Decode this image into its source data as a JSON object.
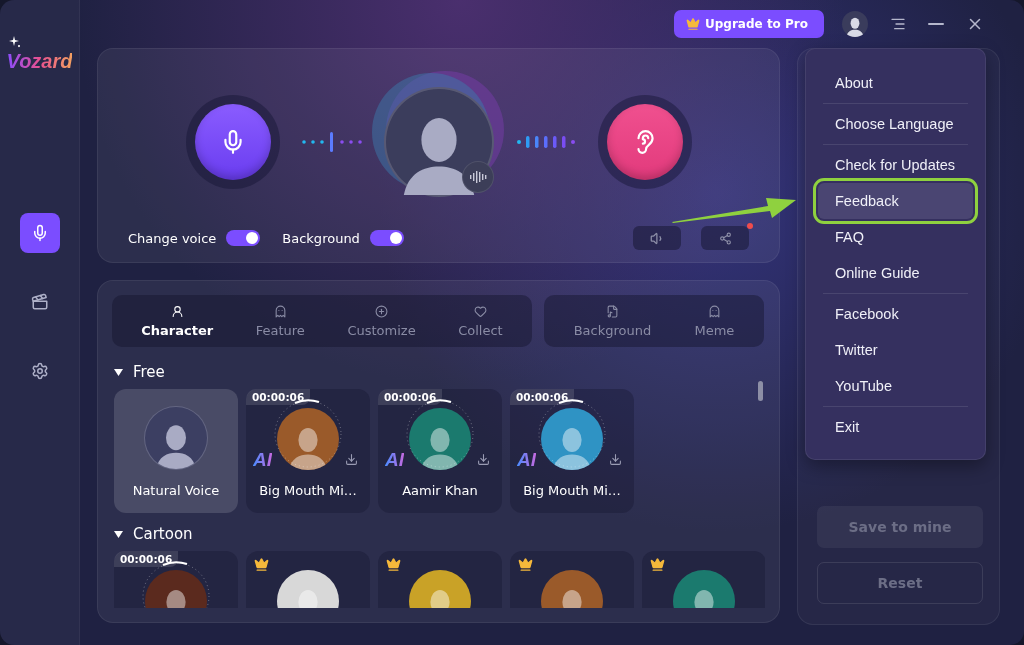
{
  "app": {
    "logo": "Vozard"
  },
  "sidebar": {
    "items": [
      {
        "kind": "voice",
        "selected": true
      },
      {
        "kind": "video",
        "selected": false
      },
      {
        "kind": "settings",
        "selected": false
      }
    ]
  },
  "top_bar": {
    "upgrade_button": "Upgrade to Pro"
  },
  "studio": {
    "toggles": [
      {
        "label": "Change voice",
        "on": true
      },
      {
        "label": "Background",
        "on": true
      }
    ],
    "share_notification": true
  },
  "tab_groups": [
    {
      "tabs": [
        {
          "label": "Character",
          "selected": true
        },
        {
          "label": "Feature",
          "selected": false
        },
        {
          "label": "Customize",
          "selected": false
        },
        {
          "label": "Collect",
          "selected": false
        }
      ]
    },
    {
      "tabs": [
        {
          "label": "Background",
          "selected": false
        },
        {
          "label": "Meme",
          "selected": false
        }
      ]
    }
  ],
  "sections": [
    {
      "title": "Free",
      "expanded": true,
      "cards": [
        {
          "kind": "natural",
          "name": "Natural Voice",
          "selected": true
        },
        {
          "kind": "voice",
          "name": "Big Mouth Mi…",
          "time": "00:00:06",
          "badge": "AI",
          "premium": false,
          "selected": false
        },
        {
          "kind": "voice",
          "name": "Aamir Khan",
          "time": "00:00:06",
          "badge": "AI",
          "premium": false,
          "selected": false
        },
        {
          "kind": "voice",
          "name": "Big Mouth Mi…",
          "time": "00:00:06",
          "badge": "AI",
          "premium": false,
          "selected": false
        }
      ]
    },
    {
      "title": "Cartoon",
      "expanded": true,
      "cards": [
        {
          "kind": "voice",
          "time": "00:00:06",
          "premium": false,
          "selected": false
        },
        {
          "kind": "voice",
          "premium": true,
          "selected": false
        },
        {
          "kind": "voice",
          "premium": true,
          "selected": false
        },
        {
          "kind": "voice",
          "premium": true,
          "selected": false
        },
        {
          "kind": "voice",
          "premium": true,
          "selected": false
        }
      ]
    }
  ],
  "menu": {
    "groups": [
      {
        "items": [
          {
            "label": "About",
            "selected": false
          }
        ]
      },
      {
        "items": [
          {
            "label": "Choose Language",
            "selected": false
          }
        ]
      },
      {
        "items": [
          {
            "label": "Check for Updates",
            "selected": false
          },
          {
            "label": "Feedback",
            "selected": true
          },
          {
            "label": "FAQ",
            "selected": false
          },
          {
            "label": "Online Guide",
            "selected": false
          }
        ]
      },
      {
        "items": [
          {
            "label": "Facebook",
            "selected": false
          },
          {
            "label": "Twitter",
            "selected": false
          },
          {
            "label": "YouTube",
            "selected": false
          }
        ]
      },
      {
        "items": [
          {
            "label": "Exit",
            "selected": false
          }
        ]
      }
    ]
  },
  "actions": [
    {
      "label": "Save to mine",
      "kind": "filled",
      "disabled": true
    },
    {
      "label": "Reset",
      "kind": "outline",
      "disabled": true
    }
  ]
}
